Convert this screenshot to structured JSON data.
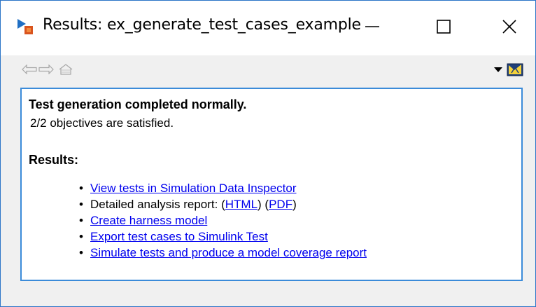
{
  "window": {
    "title": "Results: ex_generate_test_cases_example",
    "controls": {
      "minimize": "—",
      "maximize": "☐",
      "close": "✕"
    }
  },
  "toolbar": {
    "back_icon": "back-arrow-icon",
    "forward_icon": "forward-arrow-icon",
    "home_icon": "home-icon",
    "dropdown_icon": "dropdown-triangle-icon",
    "help_icon": "help-icon"
  },
  "content": {
    "status_heading": "Test generation completed normally.",
    "status_line": "2/2 objectives are satisfied.",
    "results_heading": "Results:",
    "items": {
      "view_tests": "View tests in Simulation Data Inspector",
      "report_prefix": "Detailed analysis report: (",
      "report_html": "HTML",
      "report_mid": ") (",
      "report_pdf": "PDF",
      "report_suffix": ")",
      "create_harness": "Create harness model",
      "export_tests": "Export test cases to Simulink Test",
      "simulate_tests": "Simulate tests and produce a model coverage report"
    }
  },
  "colors": {
    "link": "#0000ee",
    "window_border": "#2b74c7",
    "content_border": "#3b8bd9",
    "background": "#f0f0f0"
  }
}
